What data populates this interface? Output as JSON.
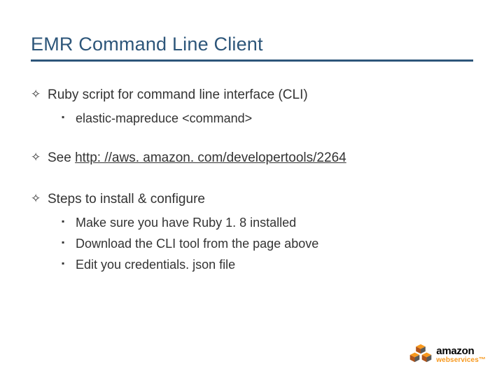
{
  "title": "EMR Command Line Client",
  "items": [
    {
      "text": "Ruby script for command line interface (CLI)",
      "sub": [
        {
          "text": "elastic-mapreduce <command>"
        }
      ]
    },
    {
      "prefix": "See ",
      "link_text": "http: //aws. amazon. com/developertools/2264",
      "sub": []
    },
    {
      "text": "Steps to install & configure",
      "sub": [
        {
          "text": "Make sure you have Ruby 1. 8 installed"
        },
        {
          "text": "Download the CLI tool from the page above"
        },
        {
          "text": "Edit you credentials. json file"
        }
      ]
    }
  ],
  "logo": {
    "brand": "amazon",
    "sub": "webservices",
    "tm": "™"
  }
}
